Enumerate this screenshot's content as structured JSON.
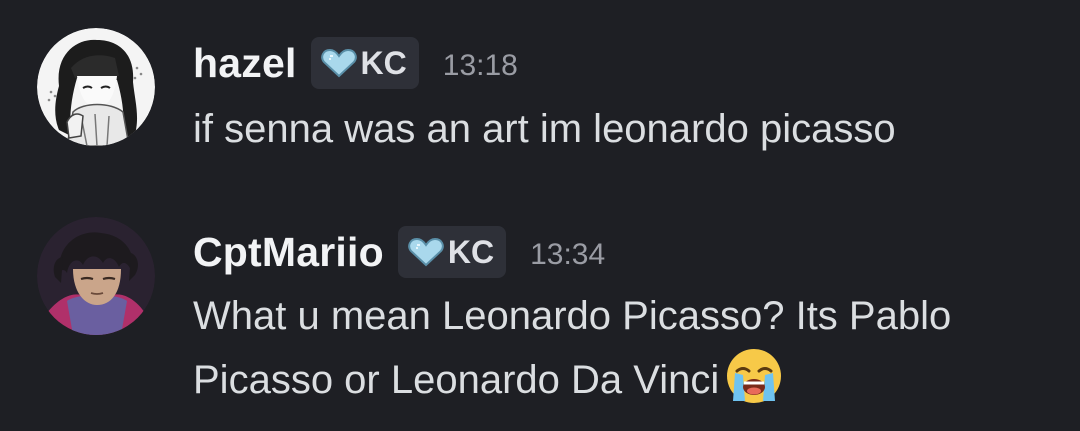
{
  "messages": [
    {
      "username": "hazel",
      "tag": {
        "label": "KC",
        "icon": "heart-icon"
      },
      "timestamp": "13:18",
      "text": "if senna was an art im leonardo picasso",
      "avatar": "manga-girl-avatar"
    },
    {
      "username": "CptMariio",
      "tag": {
        "label": "KC",
        "icon": "heart-icon"
      },
      "timestamp": "13:34",
      "text": "What u mean Leonardo Picasso? Its Pablo Picasso or Leonardo Da Vinci",
      "emoji": "loudly-crying-face",
      "avatar": "anime-man-avatar"
    }
  ],
  "colors": {
    "background": "#1e1f24",
    "username": "#f2f3f5",
    "message_text": "#dbdee1",
    "timestamp": "#9a9ca4",
    "tag_background": "#2e3038",
    "tag_heart": "#a9d8ec"
  }
}
